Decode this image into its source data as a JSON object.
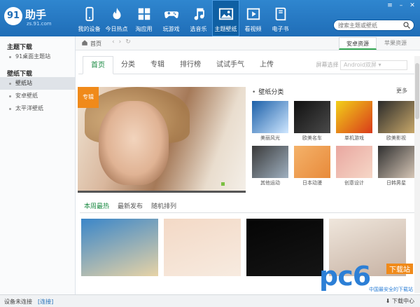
{
  "app": {
    "logo_mark": "91",
    "logo_name": "助手",
    "logo_url": "zs.91.com"
  },
  "nav": [
    {
      "label": "我的设备",
      "icon": "phone-icon"
    },
    {
      "label": "今日热点",
      "icon": "fire-icon"
    },
    {
      "label": "淘应用",
      "icon": "apps-grid-icon"
    },
    {
      "label": "玩游戏",
      "icon": "gamepad-icon"
    },
    {
      "label": "选音乐",
      "icon": "music-note-icon"
    },
    {
      "label": "主题壁纸",
      "icon": "picture-icon",
      "active": true
    },
    {
      "label": "看视频",
      "icon": "film-icon"
    },
    {
      "label": "电子书",
      "icon": "book-icon"
    }
  ],
  "search": {
    "placeholder": "搜索主题或壁纸"
  },
  "sidebar": {
    "sections": [
      {
        "title": "主题下载",
        "items": [
          "91桌面主题站"
        ]
      },
      {
        "title": "壁纸下载",
        "items": [
          "壁纸站",
          "安卓壁纸",
          "太平洋壁纸"
        ]
      }
    ]
  },
  "crumb": {
    "home_label": "首页"
  },
  "source_tabs": [
    "安卓资源",
    "苹果资源"
  ],
  "content_tabs": [
    "首页",
    "分类",
    "专辑",
    "排行榜",
    "试试手气",
    "上传"
  ],
  "screen_select": {
    "label": "屏幕选择",
    "value": "Android双屏"
  },
  "banner": {
    "tag": "专辑"
  },
  "categories": {
    "title": "壁纸分类",
    "more": "更多",
    "items": [
      {
        "label": "美丽风光",
        "colors": [
          "#1b5fa8",
          "#cfe7ff"
        ]
      },
      {
        "label": "欧美名车",
        "colors": [
          "#101010",
          "#4a4a4a"
        ]
      },
      {
        "label": "单机游戏",
        "colors": [
          "#f2d019",
          "#d93a1a"
        ]
      },
      {
        "label": "欧美影视",
        "colors": [
          "#2a2a2a",
          "#c8a86a"
        ]
      },
      {
        "label": "其他运动",
        "colors": [
          "#3a3a3a",
          "#9fb0c0"
        ]
      },
      {
        "label": "日本动漫",
        "colors": [
          "#f4b26a",
          "#e88a3a"
        ]
      },
      {
        "label": "创意设计",
        "colors": [
          "#e9a7a0",
          "#f6d7c7"
        ]
      },
      {
        "label": "日韩男星",
        "colors": [
          "#2f2f2f",
          "#d6c6b6"
        ]
      }
    ]
  },
  "lower_tabs": [
    "本周最热",
    "最新发布",
    "随机排列"
  ],
  "wallpapers": [
    {
      "colors": [
        "#3a86c9",
        "#e7d3a6"
      ]
    },
    {
      "colors": [
        "#f3d9c6",
        "#f7ebe0"
      ]
    },
    {
      "colors": [
        "#050505",
        "#151515"
      ]
    },
    {
      "colors": [
        "#efe6dc",
        "#c6b1a2"
      ]
    }
  ],
  "watermark": {
    "big": "pc6",
    "download": "下载站",
    "slogan": "中国最安全的下载站"
  },
  "status": {
    "device": "设备未连接",
    "connect": "[连接]",
    "download_center": "下载中心"
  }
}
